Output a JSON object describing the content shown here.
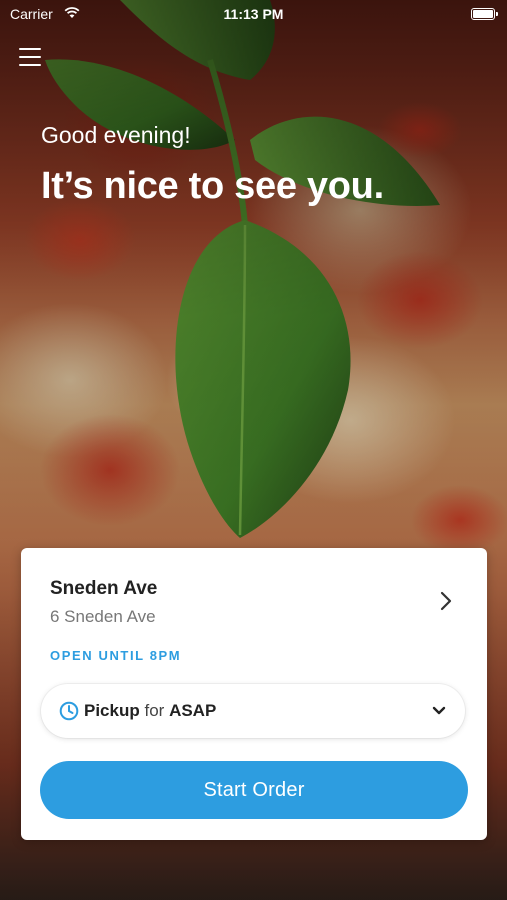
{
  "status_bar": {
    "carrier": "Carrier",
    "time": "11:13 PM",
    "wifi_icon": "wifi-icon",
    "battery_icon": "battery-icon"
  },
  "hero": {
    "greeting": "Good evening!",
    "headline": "It’s nice to see you."
  },
  "location": {
    "name": "Sneden Ave",
    "address": "6 Sneden Ave",
    "hours": "OPEN UNTIL 8PM"
  },
  "order": {
    "mode": "Pickup",
    "connector": "for",
    "time": "ASAP",
    "start_label": "Start Order"
  },
  "colors": {
    "accent": "#2d9de0",
    "card_bg": "#ffffff"
  }
}
